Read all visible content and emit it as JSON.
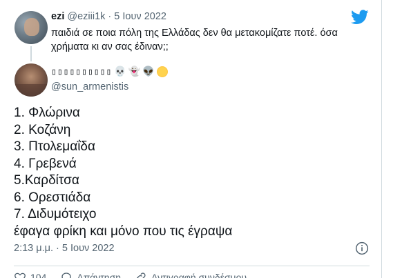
{
  "parent_tweet": {
    "display_name": "ezi",
    "handle": "@eziii1k",
    "separator": "·",
    "date": "5 Ιουν 2022",
    "text": "παιδιά σε ποια πόλη της Ελλάδας δεν θα μετακομίζατε ποτέ. όσα χρήματα κι αν σας έδιναν;;"
  },
  "main_tweet": {
    "display_name_boxes": "▯▯▯▯▯▯▯▯▯▯",
    "name_emojis": [
      "💀",
      "👻",
      "👽"
    ],
    "handle": "@sun_armenistis",
    "lines": [
      "1. Φλώρινα",
      "2. Κοζάνη",
      "3. Πτολεμαΐδα",
      "4. Γρεβενά",
      "5.Καρδίτσα",
      "6. Ορεστιάδα",
      "7. Διδυμότειχο",
      "έφαγα φρίκη και μόνο που τις έγραψα"
    ],
    "timestamp": "2:13 μ.μ. · 5 Ιουν 2022"
  },
  "actions": {
    "like_count": "104",
    "reply_label": "Απάντηση",
    "copy_link_label": "Αντιγραφή συνδέσμου"
  },
  "icons": {
    "bird": "twitter-bird-icon",
    "info": "info-icon",
    "heart": "heart-icon",
    "reply": "reply-icon",
    "link": "link-icon"
  },
  "colors": {
    "brand_blue": "#1d9bf0",
    "text_primary": "#0f1419",
    "text_secondary": "#536471",
    "border": "#cfd9de"
  }
}
